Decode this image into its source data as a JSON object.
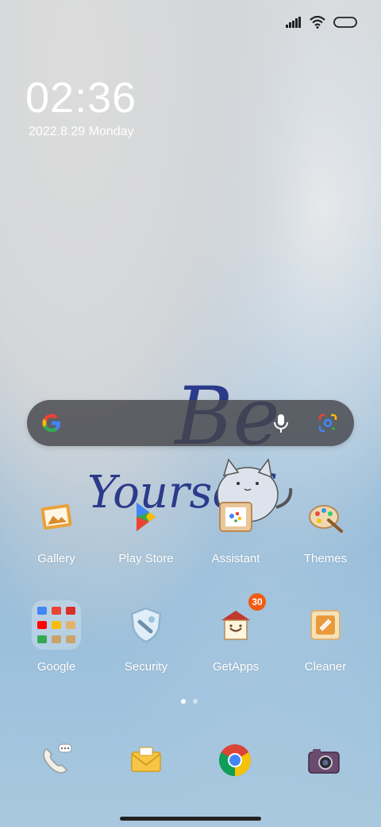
{
  "lockscreen": {
    "time": "02:36",
    "date": "2022.8.29 Monday"
  },
  "status_bar": {
    "icons": [
      "signal-icon",
      "wifi-icon",
      "battery-icon"
    ]
  },
  "wallpaper": {
    "text_line1": "Be",
    "text_line2": "Yourself"
  },
  "search_bar": {
    "icons": [
      "google-logo-icon",
      "microphone-icon",
      "google-lens-icon"
    ]
  },
  "apps_row1": [
    {
      "label": "Gallery",
      "icon": "gallery-icon"
    },
    {
      "label": "Play Store",
      "icon": "play-store-icon"
    },
    {
      "label": "Assistant",
      "icon": "assistant-icon"
    },
    {
      "label": "Themes",
      "icon": "themes-icon"
    }
  ],
  "apps_row2": [
    {
      "label": "Google",
      "icon": "google-folder-icon"
    },
    {
      "label": "Security",
      "icon": "security-icon"
    },
    {
      "label": "GetApps",
      "icon": "getapps-icon",
      "badge": "30"
    },
    {
      "label": "Cleaner",
      "icon": "cleaner-icon"
    }
  ],
  "page_indicator": {
    "pages": 2,
    "current": 1
  },
  "dock": [
    {
      "icon": "phone-icon"
    },
    {
      "icon": "messages-icon"
    },
    {
      "icon": "chrome-icon"
    },
    {
      "icon": "camera-icon"
    }
  ],
  "colors": {
    "badge": "#f45a12",
    "search_bar_bg": "#46464b",
    "handwriting": "#2b3a8a"
  }
}
